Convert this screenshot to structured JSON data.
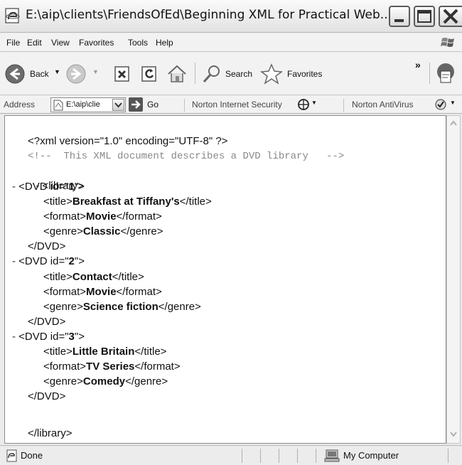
{
  "window": {
    "title": "E:\\aip\\clients\\FriendsOfEd\\Beginning XML for Practical Web..."
  },
  "menu": [
    "File",
    "Edit",
    "View",
    "Favorites",
    "Tools",
    "Help"
  ],
  "toolbar": {
    "back_label": "Back",
    "search_label": "Search",
    "favorites_label": "Favorites",
    "overflow_label": "»"
  },
  "address": {
    "label": "Address",
    "value": "E:\\aip\\clie",
    "go_label": "Go",
    "norton_security": "Norton Internet Security",
    "norton_antivirus": "Norton AntiVirus"
  },
  "xml": {
    "declaration": "<?xml version=\"1.0\" encoding=\"UTF-8\" ?>",
    "comment": "<!--  This XML document describes a DVD library   -->",
    "root_open": "<library>",
    "root_close": "</library>",
    "dvds": [
      {
        "id": "1",
        "title": "Breakfast at Tiffany's",
        "format": "Movie",
        "genre": "Classic"
      },
      {
        "id": "2",
        "title": "Contact",
        "format": "Movie",
        "genre": "Science fiction"
      },
      {
        "id": "3",
        "title": "Little Britain",
        "format": "TV Series",
        "genre": "Comedy"
      }
    ]
  },
  "status": {
    "left": "Done",
    "zone": "My Computer"
  },
  "icons": {
    "app": "ie-page-icon",
    "back": "back-arrow-icon",
    "forward": "forward-arrow-icon",
    "stop": "stop-icon",
    "refresh": "refresh-icon",
    "home": "home-icon",
    "search": "search-icon",
    "favorites": "favorites-star-icon",
    "go": "go-arrow-icon",
    "status": "page-done-icon",
    "computer": "my-computer-icon"
  }
}
